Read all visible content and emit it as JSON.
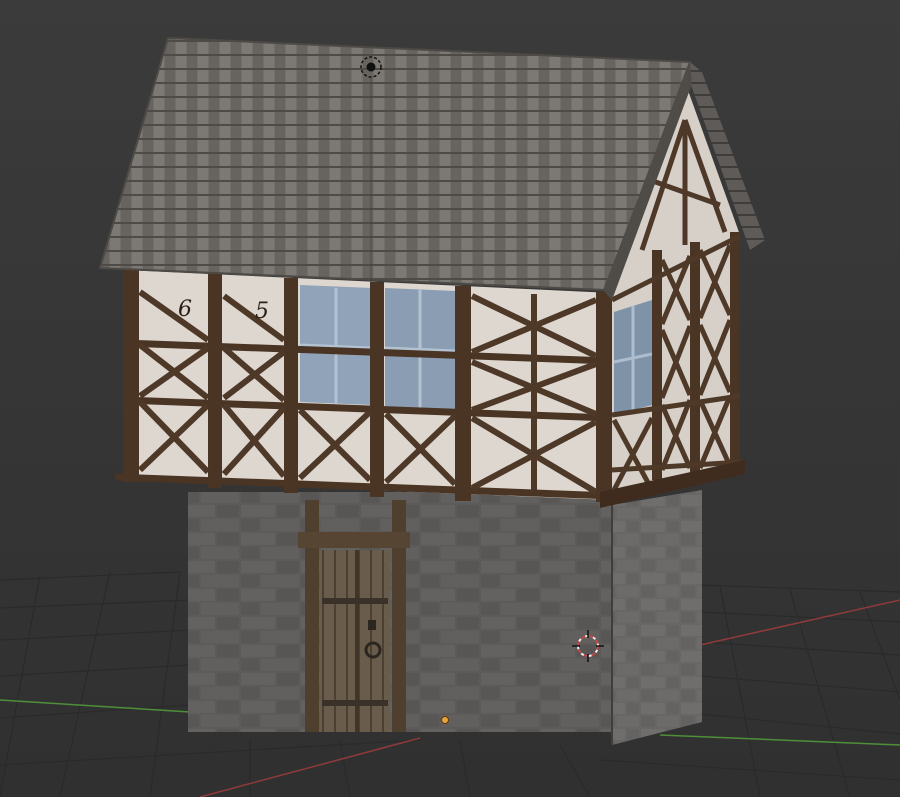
{
  "viewport": {
    "name": "3d-viewport",
    "background_top": "#3a3a3a",
    "background_bottom": "#2e2e2e",
    "grid_color": "#262626",
    "x_axis_color": "#8f3a3a",
    "y_axis_color": "#4f8f3a"
  },
  "scene": {
    "object": "timber-framed-house",
    "gable_date_digits": [
      "6",
      "5"
    ],
    "icons": {
      "camera": "camera-object-icon",
      "cursor": "3d-cursor-icon",
      "origin": "object-origin-icon"
    }
  },
  "colors": {
    "roof": "#6f6c6a",
    "roof_shade": "#55524f",
    "stone": "#5b5a58",
    "stone_dark": "#4a4948",
    "timber": "#4a3424",
    "plaster": "#d9d4cc",
    "glass": "#8ea0b4",
    "door": "#5f5343"
  }
}
